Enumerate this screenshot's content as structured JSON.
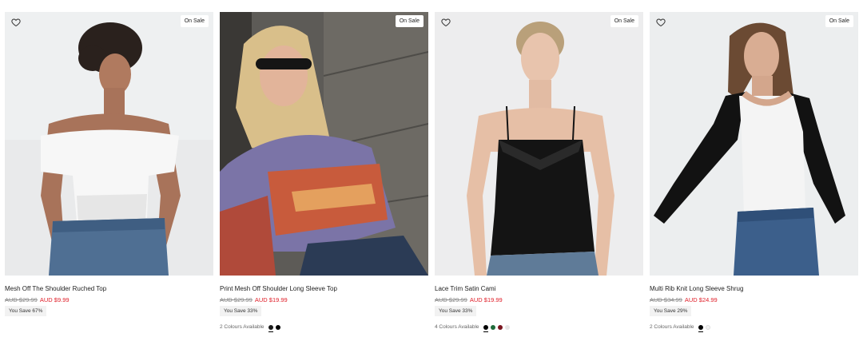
{
  "products": [
    {
      "name": "Mesh Off The Shoulder Ruched Top",
      "badge": "On Sale",
      "old_price": "AUD $29.99",
      "new_price": "AUD $9.99",
      "save": "You Save 67%",
      "colours_label": "",
      "swatches": [],
      "wishlist_icon": "heart-outline-icon"
    },
    {
      "name": "Print Mesh Off Shoulder Long Sleeve Top",
      "badge": "On Sale",
      "old_price": "AUD $29.99",
      "new_price": "AUD $19.99",
      "save": "You Save 33%",
      "colours_label": "2 Colours Available",
      "swatches": [
        "#1a1a1a",
        "#000000"
      ],
      "wishlist_icon": "heart-outline-icon"
    },
    {
      "name": "Lace Trim Satin Cami",
      "badge": "On Sale",
      "old_price": "AUD $29.99",
      "new_price": "AUD $19.99",
      "save": "You Save 33%",
      "colours_label": "4 Colours Available",
      "swatches": [
        "#000000",
        "#1f6b3a",
        "#7a1620",
        "#e6e6e6"
      ],
      "wishlist_icon": "heart-outline-icon"
    },
    {
      "name": "Multi Rib Knit Long Sleeve Shrug",
      "badge": "On Sale",
      "old_price": "AUD $34.99",
      "new_price": "AUD $24.99",
      "save": "You Save 29%",
      "colours_label": "2 Colours Available",
      "swatches": [
        "#000000",
        "#f2f2f2"
      ],
      "wishlist_icon": "heart-outline-icon"
    }
  ],
  "colors": {
    "sale_price": "#e0202a",
    "old_price": "#8a8a8a",
    "save_bg": "#f2f2f2"
  }
}
